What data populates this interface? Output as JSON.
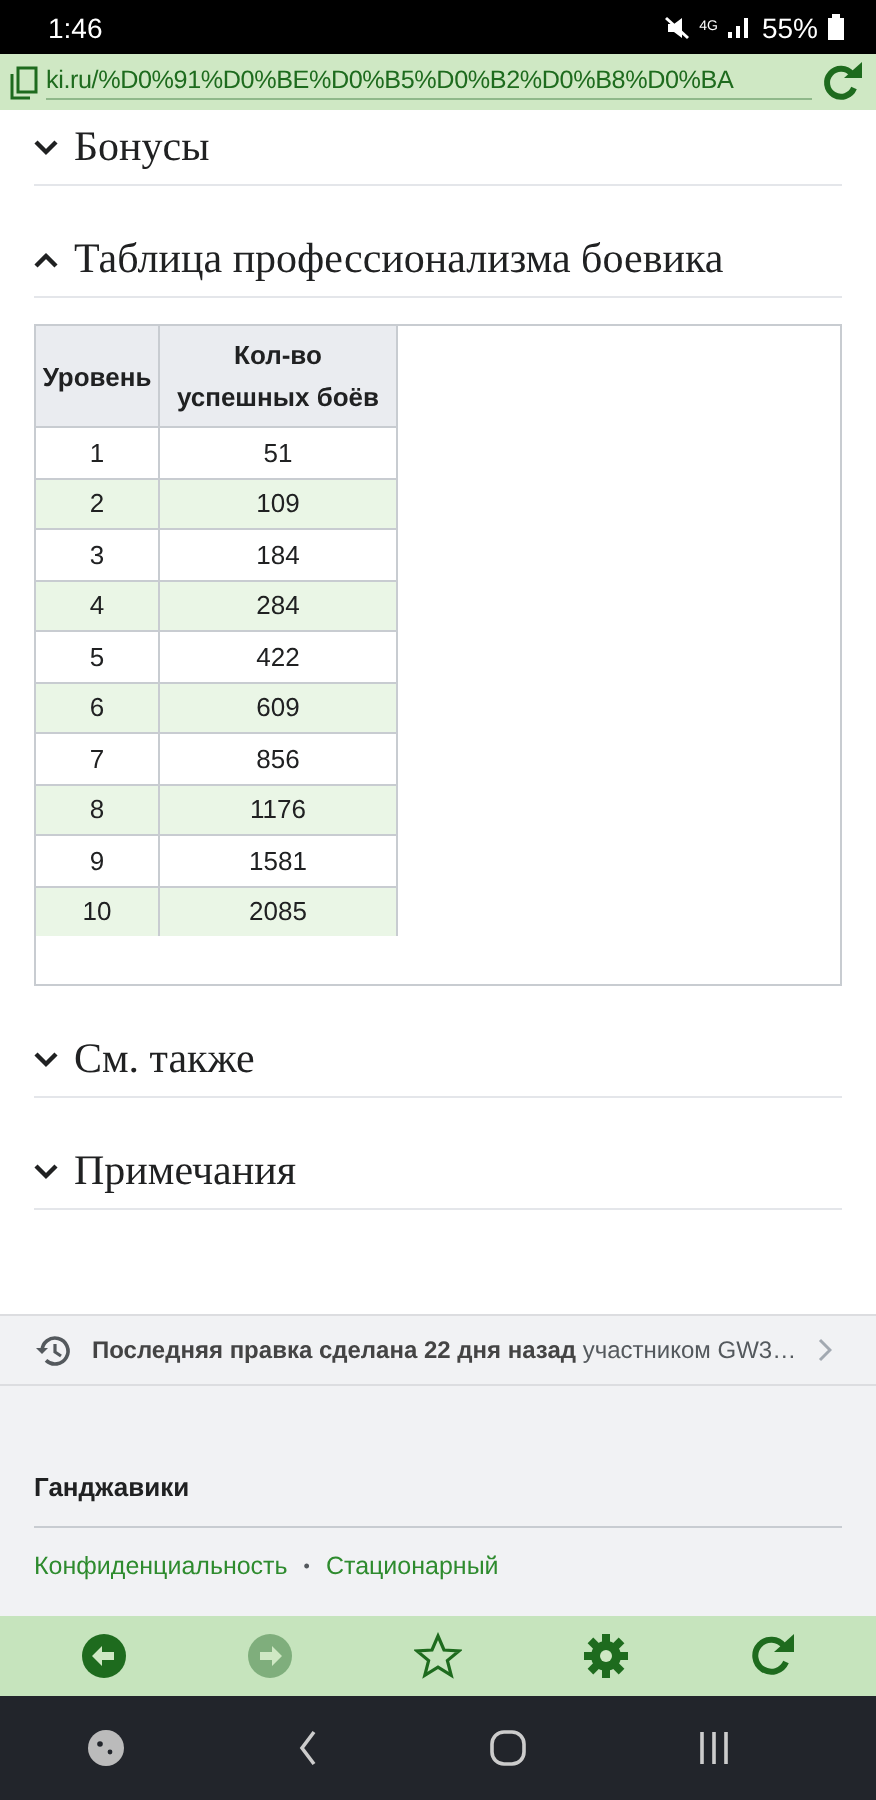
{
  "status_bar": {
    "time": "1:46",
    "network": "4G",
    "battery": "55%"
  },
  "url_bar": {
    "url": "ki.ru/%D0%91%D0%BE%D0%B5%D0%B2%D0%B8%D0%BA"
  },
  "sections": [
    {
      "title": "Бонусы",
      "expanded": false
    },
    {
      "title": "Таблица профессионализма боевика",
      "expanded": true,
      "table": {
        "columns": [
          "Уровень",
          "Кол-во успешных боёв"
        ],
        "rows": [
          [
            "1",
            "51"
          ],
          [
            "2",
            "109"
          ],
          [
            "3",
            "184"
          ],
          [
            "4",
            "284"
          ],
          [
            "5",
            "422"
          ],
          [
            "6",
            "609"
          ],
          [
            "7",
            "856"
          ],
          [
            "8",
            "1176"
          ],
          [
            "9",
            "1581"
          ],
          [
            "10",
            "2085"
          ]
        ]
      }
    },
    {
      "title": "См. также",
      "expanded": false
    },
    {
      "title": "Примечания",
      "expanded": false
    }
  ],
  "last_edit": "**Последняя правка сделана 22 дня назад** участником GW3…",
  "footer": {
    "site_name": "Ганджавики",
    "links": [
      "Конфиденциальность",
      "Стационарный"
    ],
    "separator": "•"
  },
  "toolbar": [
    {
      "kind": "back",
      "disabled": false
    },
    {
      "kind": "forward",
      "disabled": true
    },
    {
      "kind": "bookmark",
      "disabled": false
    },
    {
      "kind": "settings",
      "disabled": false
    },
    {
      "kind": "reload",
      "disabled": false
    }
  ]
}
